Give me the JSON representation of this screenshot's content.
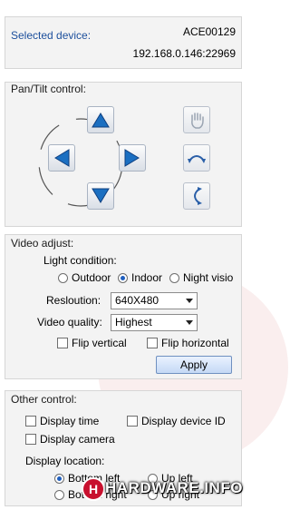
{
  "device": {
    "selected_label": "Selected device:",
    "device_id": "ACE00129",
    "address": "192.168.0.146:22969"
  },
  "pantilt": {
    "title": "Pan/Tilt control:",
    "buttons": {
      "up": "up-arrow-icon",
      "left": "left-arrow-icon",
      "right": "right-arrow-icon",
      "down": "down-arrow-icon",
      "hand": "hand-icon",
      "rotate_cw": "rotate-horizontal-icon",
      "rotate_ccw": "rotate-vertical-icon"
    }
  },
  "video": {
    "title": "Video adjust:",
    "light_label": "Light condition:",
    "light_options": [
      "Outdoor",
      "Indoor",
      "Night visio"
    ],
    "light_selected": "Indoor",
    "resolution_label": "Resloution:",
    "resolution_value": "640X480",
    "quality_label": "Video quality:",
    "quality_value": "Highest",
    "flip_vertical": "Flip vertical",
    "flip_horizontal": "Flip horizontal",
    "apply_label": "Apply"
  },
  "other": {
    "title": "Other control:",
    "display_time": "Display time",
    "display_device_id": "Display device ID",
    "display_camera": "Display camera",
    "location_label": "Display location:",
    "loc_bottom_left": "Bottom left",
    "loc_up_left": "Up left",
    "loc_bottom_right": "Bottom right",
    "loc_up_right": "Up right",
    "location_selected": "Bottom left"
  },
  "watermark": {
    "text": "HARDWARE.INFO"
  },
  "colors": {
    "accent_blue": "#1f5fbf",
    "arrow_blue": "#1b6fc1",
    "label_blue": "#1c4f9c",
    "watermark_red": "#c8102e"
  }
}
